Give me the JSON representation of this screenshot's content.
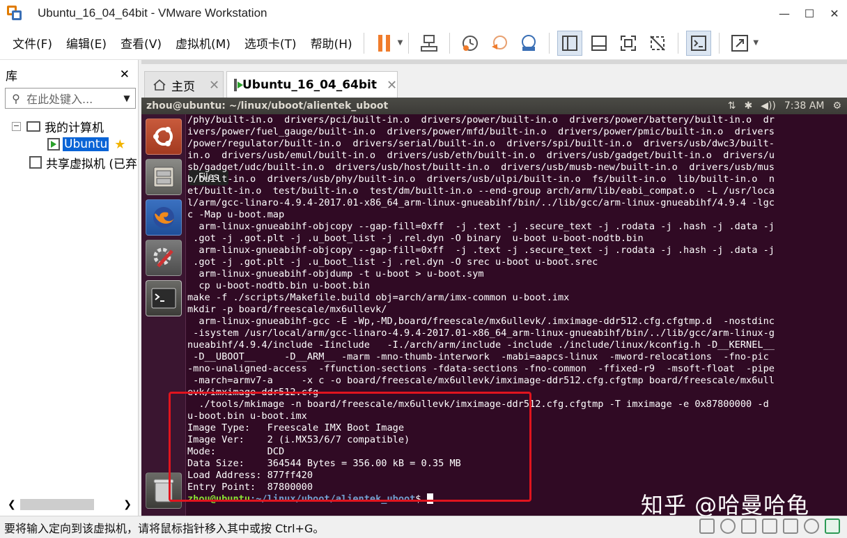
{
  "window": {
    "title": "Ubuntu_16_04_64bit - VMware Workstation",
    "minimize": "—",
    "maximize": "☐",
    "close": "✕"
  },
  "menu": [
    "文件(F)",
    "编辑(E)",
    "查看(V)",
    "虚拟机(M)",
    "选项卡(T)",
    "帮助(H)"
  ],
  "library": {
    "title": "库",
    "close": "✕",
    "search_placeholder": "在此处键入...",
    "tree": {
      "my_computer": "我的计算机",
      "vm": "Ubuntu",
      "shared": "共享虚拟机 (已弃"
    }
  },
  "tabs": {
    "home": "主页",
    "vm": "Ubuntu_16_04_64bit",
    "close": "✕"
  },
  "ubuntu": {
    "window_title": "zhou@ubuntu: ~/linux/uboot/alientek_uboot",
    "time": "7:38 AM",
    "tooltip": "Files"
  },
  "terminal": {
    "lines": [
      "/phy/built-in.o  drivers/pci/built-in.o  drivers/power/built-in.o  drivers/power/battery/built-in.o  dr",
      "ivers/power/fuel_gauge/built-in.o  drivers/power/mfd/built-in.o  drivers/power/pmic/built-in.o  drivers",
      "/power/regulator/built-in.o  drivers/serial/built-in.o  drivers/spi/built-in.o  drivers/usb/dwc3/built-",
      "in.o  drivers/usb/emul/built-in.o  drivers/usb/eth/built-in.o  drivers/usb/gadget/built-in.o  drivers/u",
      "sb/gadget/udc/built-in.o  drivers/usb/host/built-in.o  drivers/usb/musb-new/built-in.o  drivers/usb/mus",
      "b/built-in.o  drivers/usb/phy/built-in.o  drivers/usb/ulpi/built-in.o  fs/built-in.o  lib/built-in.o  n",
      "et/built-in.o  test/built-in.o  test/dm/built-in.o --end-group arch/arm/lib/eabi_compat.o  -L /usr/loca",
      "l/arm/gcc-linaro-4.9.4-2017.01-x86_64_arm-linux-gnueabihf/bin/../lib/gcc/arm-linux-gnueabihf/4.9.4 -lgc",
      "c -Map u-boot.map",
      "  arm-linux-gnueabihf-objcopy --gap-fill=0xff  -j .text -j .secure_text -j .rodata -j .hash -j .data -j",
      " .got -j .got.plt -j .u_boot_list -j .rel.dyn -O binary  u-boot u-boot-nodtb.bin",
      "  arm-linux-gnueabihf-objcopy --gap-fill=0xff  -j .text -j .secure_text -j .rodata -j .hash -j .data -j",
      " .got -j .got.plt -j .u_boot_list -j .rel.dyn -O srec u-boot u-boot.srec",
      "  arm-linux-gnueabihf-objdump -t u-boot > u-boot.sym",
      "  cp u-boot-nodtb.bin u-boot.bin",
      "make -f ./scripts/Makefile.build obj=arch/arm/imx-common u-boot.imx",
      "mkdir -p board/freescale/mx6ullevk/",
      "  arm-linux-gnueabihf-gcc -E -Wp,-MD,board/freescale/mx6ullevk/.imximage-ddr512.cfg.cfgtmp.d  -nostdinc",
      " -isystem /usr/local/arm/gcc-linaro-4.9.4-2017.01-x86_64_arm-linux-gnueabihf/bin/../lib/gcc/arm-linux-g",
      "nueabihf/4.9.4/include -Iinclude   -I./arch/arm/include -include ./include/linux/kconfig.h -D__KERNEL__",
      " -D__UBOOT__     -D__ARM__ -marm -mno-thumb-interwork  -mabi=aapcs-linux  -mword-relocations  -fno-pic",
      "-mno-unaligned-access  -ffunction-sections -fdata-sections -fno-common  -ffixed-r9  -msoft-float  -pipe",
      " -march=armv7-a     -x c -o board/freescale/mx6ullevk/imximage-ddr512.cfg.cfgtmp board/freescale/mx6ull",
      "evk/imximage-ddr512.cfg",
      "  ./tools/mkimage -n board/freescale/mx6ullevk/imximage-ddr512.cfg.cfgtmp -T imximage -e 0x87800000 -d",
      "u-boot.bin u-boot.imx",
      "Image Type:   Freescale IMX Boot Image",
      "Image Ver:    2 (i.MX53/6/7 compatible)",
      "Mode:         DCD",
      "Data Size:    364544 Bytes = 356.00 kB = 0.35 MB",
      "Load Address: 877ff420",
      "Entry Point:  87800000"
    ],
    "prompt_user": "zhou@ubuntu",
    "prompt_path": ":~/linux/uboot/alientek_uboot",
    "prompt_end": "$ "
  },
  "watermark": "知乎 @哈曼哈龟",
  "status_bar": "要将输入定向到该虚拟机，请将鼠标指针移入其中或按 Ctrl+G。",
  "colors": {
    "terminal_bg": "#300a24",
    "highlight_box": "#e0141e",
    "prompt_user": "#8ae234",
    "prompt_path": "#729fcf"
  }
}
